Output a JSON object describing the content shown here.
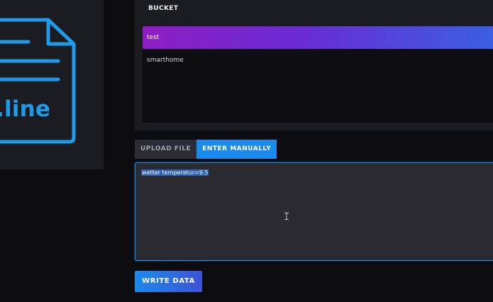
{
  "illustration": {
    "text": ".line",
    "icon": "document-icon",
    "color": "#1d9bea"
  },
  "bucket": {
    "title": "BUCKET",
    "items": [
      {
        "label": "test",
        "selected": true
      },
      {
        "label": "smarthome",
        "selected": false
      }
    ]
  },
  "tabs": [
    {
      "label": "UPLOAD FILE",
      "active": false
    },
    {
      "label": "ENTER MANUALLY",
      "active": true
    }
  ],
  "editor": {
    "value": "wetter temperatur=9.5",
    "cursor_icon": "text-cursor-icon"
  },
  "write_button": {
    "label": "WRITE DATA"
  },
  "colors": {
    "accent": "#1a8bec",
    "selected_gradient_start": "#8e1ec4",
    "selected_gradient_end": "#3b5fe0",
    "panel": "#1b1b22",
    "background": "#0c0c11"
  }
}
